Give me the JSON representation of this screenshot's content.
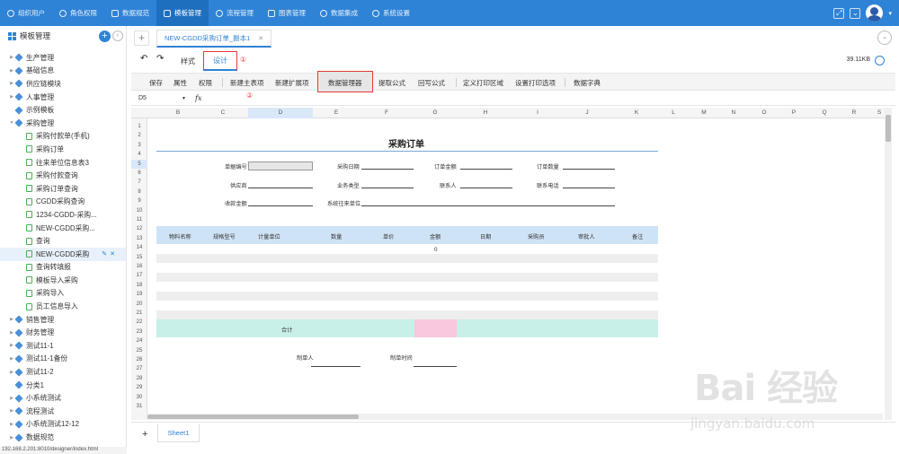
{
  "topnav": {
    "items": [
      {
        "label": "组织用户",
        "icon": "org-icon"
      },
      {
        "label": "角色权限",
        "icon": "role-icon"
      },
      {
        "label": "数据规范",
        "icon": "data-spec-icon"
      },
      {
        "label": "模板管理",
        "icon": "template-icon"
      },
      {
        "label": "流程管理",
        "icon": "flow-icon"
      },
      {
        "label": "图表管理",
        "icon": "chart-icon"
      },
      {
        "label": "数据集成",
        "icon": "integration-icon"
      },
      {
        "label": "系统设置",
        "icon": "settings-icon"
      }
    ],
    "active_index": 3,
    "brand_color": "#2f83d6"
  },
  "sidebar": {
    "title": "模板管理",
    "items": [
      {
        "label": "生产管理",
        "type": "folder"
      },
      {
        "label": "基础信息",
        "type": "folder"
      },
      {
        "label": "供应链模块",
        "type": "folder"
      },
      {
        "label": "人事管理",
        "type": "folder"
      },
      {
        "label": "示例模板",
        "type": "folder-leaf"
      },
      {
        "label": "采购管理",
        "type": "folder-open"
      },
      {
        "label": "采购付款单(手机)",
        "type": "doc"
      },
      {
        "label": "采购订单",
        "type": "doc"
      },
      {
        "label": "往来单位信息表3",
        "type": "doc"
      },
      {
        "label": "采购付款查询",
        "type": "doc"
      },
      {
        "label": "采购订单查询",
        "type": "doc"
      },
      {
        "label": "CGDD采购查询",
        "type": "doc"
      },
      {
        "label": "1234-CGDD-采购...",
        "type": "doc"
      },
      {
        "label": "NEW-CGDD采购...",
        "type": "doc"
      },
      {
        "label": "查询",
        "type": "doc"
      },
      {
        "label": "NEW-CGDD采购",
        "type": "doc-selected"
      },
      {
        "label": "查询转填报",
        "type": "doc"
      },
      {
        "label": "模板导入采购",
        "type": "doc"
      },
      {
        "label": "采购导入",
        "type": "doc"
      },
      {
        "label": "员工信息导入",
        "type": "doc"
      },
      {
        "label": "销售管理",
        "type": "folder"
      },
      {
        "label": "财务管理",
        "type": "folder"
      },
      {
        "label": "测试11-1",
        "type": "folder"
      },
      {
        "label": "测试11-1备份",
        "type": "folder"
      },
      {
        "label": "测试11-2",
        "type": "folder"
      },
      {
        "label": "分类1",
        "type": "folder-leaf"
      },
      {
        "label": "小系统测试",
        "type": "folder"
      },
      {
        "label": "流程测试",
        "type": "folder"
      },
      {
        "label": "小系统测试12-12",
        "type": "folder"
      },
      {
        "label": "数据规范",
        "type": "folder"
      }
    ]
  },
  "status_url": "192.168.2.201:8010/designer/index.html",
  "doc_tab": {
    "label": "NEW-CGDD采购订单_副本1"
  },
  "modes": {
    "style": "样式",
    "design": "设计",
    "marker1": "①"
  },
  "file_size": "39.11KB",
  "toolbar": {
    "buttons": [
      "保存",
      "属性",
      "权限",
      "新建主表项",
      "新建扩展项",
      "数据管理器",
      "提取公式",
      "回写公式",
      "定义打印区域",
      "设置打印选项",
      "数据字典"
    ],
    "marker2": "②"
  },
  "formula": {
    "cell_ref": "D5",
    "fx": "fx"
  },
  "columns": [
    "B",
    "C",
    "D",
    "E",
    "F",
    "G",
    "H",
    "I",
    "J",
    "K",
    "L",
    "M",
    "N",
    "O",
    "P",
    "Q",
    "R",
    "S"
  ],
  "active_column": "D",
  "rows": [
    "1",
    "2",
    "3",
    "4",
    "5",
    "6",
    "7",
    "8",
    "9",
    "10",
    "11",
    "12",
    "13",
    "14",
    "15",
    "16",
    "17",
    "18",
    "19",
    "20",
    "21",
    "22",
    "23",
    "24",
    "25",
    "26",
    "27",
    "28",
    "29",
    "30",
    "31"
  ],
  "active_row": "5",
  "form": {
    "title": "采购订单",
    "fields": {
      "order_no": "单据编号",
      "purchase_date": "采购日期",
      "order_amount": "订单金额",
      "order_qty": "订单数量",
      "supplier": "供应商",
      "business_type": "业务类型",
      "contact": "联系人",
      "contact_phone": "联系电话",
      "received_amount": "收款金额",
      "partner_unit": "系统往来单位"
    },
    "table_headers": [
      "物料名称",
      "规格型号",
      "计量单位",
      "数量",
      "单价",
      "金额",
      "日期",
      "采购员",
      "审批人",
      "备注"
    ],
    "amount_zero": "0",
    "total_label": "合计",
    "maker": "制单人",
    "make_time": "制单时间"
  },
  "sheet_tab": "Sheet1",
  "watermark": {
    "text": "Bai 经验",
    "url": "jingyan.baidu.com"
  }
}
